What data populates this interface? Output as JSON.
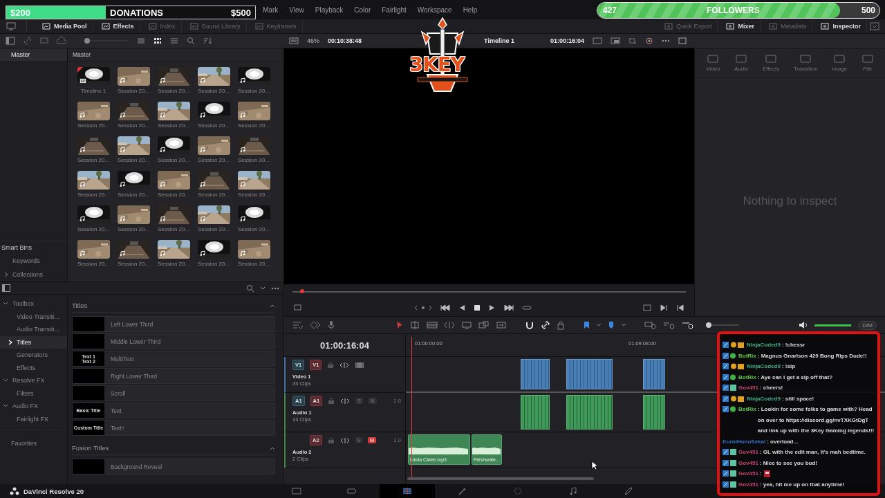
{
  "overlays": {
    "donations": {
      "current": "$200",
      "label": "DONATIONS",
      "goal": "$500",
      "level": 0.4
    },
    "followers": {
      "current": "427",
      "label": "FOLLOWERS",
      "goal": "500",
      "level": 0.86
    },
    "logo": {
      "text": "3KEY"
    }
  },
  "menu": [
    "Mark",
    "View",
    "Playback",
    "Color",
    "Fairlight",
    "Workspace",
    "Help"
  ],
  "toolbar": {
    "left": [
      {
        "label": "Media Pool",
        "selected": true
      },
      {
        "label": "Effects",
        "selected": true
      },
      {
        "label": "Index",
        "selected": false
      },
      {
        "label": "Sound Library",
        "selected": false
      },
      {
        "label": "Keyframes",
        "selected": false
      }
    ],
    "right": [
      {
        "label": "Quick Export",
        "selected": false
      },
      {
        "label": "Mixer",
        "selected": true
      },
      {
        "label": "Metadata",
        "selected": false
      },
      {
        "label": "Inspector",
        "selected": true
      }
    ]
  },
  "viewer": {
    "zoom": "46%",
    "duration": "00:10:38:48",
    "timeline": "Timeline 1",
    "timecode": "01:00:16:04",
    "scrub": {
      "level": 0.025
    }
  },
  "media_pool": {
    "size_slider": {
      "level": 0
    },
    "bins": [
      {
        "label": "Master",
        "selected": true
      }
    ],
    "smart_bins": {
      "title": "Smart Bins",
      "items": [
        {
          "label": "Keywords",
          "expandable": false
        },
        {
          "label": "Collections",
          "expandable": true
        }
      ]
    },
    "header": "Master",
    "clips": [
      {
        "label": "Timeline 1",
        "kind": "timeline"
      },
      {
        "label": "Session 20...",
        "kind": "audio"
      },
      {
        "label": "Session 20...",
        "kind": "audio"
      },
      {
        "label": "Session 20...",
        "kind": "audio"
      },
      {
        "label": "Session 20...",
        "kind": "audio"
      },
      {
        "label": "Session 20...",
        "kind": "audio"
      },
      {
        "label": "Session 20...",
        "kind": "audio"
      },
      {
        "label": "Session 20...",
        "kind": "audio"
      },
      {
        "label": "Session 20...",
        "kind": "audio"
      },
      {
        "label": "Session 20...",
        "kind": "audio"
      },
      {
        "label": "Session 20...",
        "kind": "audio"
      },
      {
        "label": "Session 20...",
        "kind": "audio"
      },
      {
        "label": "Session 20...",
        "kind": "audio"
      },
      {
        "label": "Session 20...",
        "kind": "audio"
      },
      {
        "label": "Session 20...",
        "kind": "audio"
      },
      {
        "label": "Session 20...",
        "kind": "audio"
      },
      {
        "label": "Session 20...",
        "kind": "audio"
      },
      {
        "label": "Session 20...",
        "kind": "audio"
      },
      {
        "label": "Session 20...",
        "kind": "audio"
      },
      {
        "label": "Session 20...",
        "kind": "audio"
      },
      {
        "label": "Session 20...",
        "kind": "audio"
      },
      {
        "label": "Session 20...",
        "kind": "audio"
      },
      {
        "label": "Session 20...",
        "kind": "audio"
      },
      {
        "label": "Session 20...",
        "kind": "audio"
      },
      {
        "label": "Session 20...",
        "kind": "audio"
      },
      {
        "label": "Session 20...",
        "kind": "audio"
      },
      {
        "label": "Session 20...",
        "kind": "audio"
      },
      {
        "label": "Session 20...",
        "kind": "audio"
      },
      {
        "label": "Session 20...",
        "kind": "audio"
      },
      {
        "label": "Session 20...",
        "kind": "audio"
      }
    ]
  },
  "inspector": {
    "tabs": [
      {
        "label": "Video",
        "disabled": true
      },
      {
        "label": "Audio",
        "disabled": true
      },
      {
        "label": "Effects",
        "disabled": true
      },
      {
        "label": "Transition",
        "disabled": true
      },
      {
        "label": "Image",
        "disabled": true
      },
      {
        "label": "File",
        "disabled": true
      }
    ],
    "empty_message": "Nothing to inspect"
  },
  "effects": {
    "tree": [
      {
        "label": "Toolbox",
        "expanded": true,
        "selected": false,
        "children": [
          {
            "label": "Video Transiti...",
            "selected": false
          },
          {
            "label": "Audio Transiti...",
            "selected": false
          },
          {
            "label": "Titles",
            "selected": true
          },
          {
            "label": "Generators",
            "selected": false
          },
          {
            "label": "Effects",
            "selected": false
          }
        ]
      },
      {
        "label": "Resolve FX",
        "expanded": true,
        "selected": false,
        "children": [
          {
            "label": "Filters",
            "selected": false
          }
        ]
      },
      {
        "label": "Audio FX",
        "expanded": true,
        "selected": false,
        "children": [
          {
            "label": "Fairlight FX",
            "selected": false
          }
        ]
      }
    ],
    "favorites": "Favorites",
    "sections": [
      {
        "title": "Titles",
        "expanded": true,
        "items": [
          {
            "label": "Left Lower Third"
          },
          {
            "label": "Middle Lower Third"
          },
          {
            "label": "MultiText",
            "thumb": [
              "Text 1",
              "Text 2"
            ]
          },
          {
            "label": "Right Lower Third"
          },
          {
            "label": "Scroll"
          },
          {
            "label": "Text",
            "thumb": [
              "Basic Title"
            ]
          },
          {
            "label": "Text+",
            "thumb": [
              "Custom Title"
            ]
          }
        ]
      },
      {
        "title": "Fusion Titles",
        "expanded": true,
        "items": [
          {
            "label": "Background Reveal"
          }
        ]
      }
    ]
  },
  "timeline": {
    "timecode": "01:00:16:04",
    "ruler": [
      "01:00:00:00",
      "01:09:08:00"
    ],
    "volume": {
      "level": 0.97
    },
    "dim": "DIM",
    "zoom": {
      "level": 0
    },
    "tracks": [
      {
        "kind": "video",
        "source": "V1",
        "dest": "V1",
        "name": "Video 1",
        "count": "33 Clips"
      },
      {
        "kind": "audio",
        "source": "A1",
        "dest": "A1",
        "name": "Audio 1",
        "count": "33 Clips",
        "channels": "2.0",
        "solo_label": "S",
        "mute_label": "M",
        "solo": false,
        "muted": false
      },
      {
        "kind": "audio",
        "dest": "A2",
        "name": "Audio 2",
        "count": "2 Clips",
        "channels": "2.0",
        "solo_label": "S",
        "mute_label": "M",
        "solo": false,
        "muted": true,
        "clips": [
          "Linda Claire.mp3",
          "Fleshwate..."
        ]
      }
    ]
  },
  "chat": [
    {
      "kind": "mod",
      "user": "NinjaCoded9",
      "color": "#3fae82",
      "text": ": !chessr"
    },
    {
      "kind": "bot",
      "user": "BotRix",
      "color": "#5cc545",
      "text": ": Magnus Gnarlson 420 Bong Rips Dude!!"
    },
    {
      "kind": "mod",
      "user": "NinjaCoded9",
      "color": "#3fae82",
      "text": ": !sip"
    },
    {
      "kind": "bot",
      "user": "BotRix",
      "color": "#5cc545",
      "text": ": Aye can I get a sip off that?"
    },
    {
      "kind": "sub",
      "user": "Gov451",
      "color": "#c2466a",
      "text": ": cheers!"
    },
    {
      "kind": "mod",
      "user": "NinjaCoded9",
      "color": "#3fae82",
      "text": ": still space!"
    },
    {
      "kind": "bot",
      "user": "BotRix",
      "color": "#5cc545",
      "text": ": Lookin for some folks to game with? Head on over to https://discord.gg/nvTXKGtDgT and link up with the 3Key Gaming legends!!!"
    },
    {
      "kind": "plain",
      "user": "KuroiHonoSekai",
      "color": "#3b6fc4",
      "text": ": overload..."
    },
    {
      "kind": "sub",
      "user": "Gov451",
      "color": "#c2466a",
      "text": ": GL with the edit man, It's mah bedtime."
    },
    {
      "kind": "sub",
      "user": "Gov451",
      "color": "#c2466a",
      "text": ": Nice to see you bud!"
    },
    {
      "kind": "sub",
      "user": "Gov451",
      "color": "#c2466a",
      "text": ":",
      "emote": true
    },
    {
      "kind": "sub",
      "user": "Gov451",
      "color": "#c2466a",
      "text": ": yea, hit me up on that anytime!"
    }
  ],
  "status_bar": {
    "app": "DaVinci Resolve 20",
    "pages": [
      {
        "kind": "media",
        "selected": false
      },
      {
        "kind": "cut",
        "selected": false
      },
      {
        "kind": "edit",
        "selected": true
      },
      {
        "kind": "fusion",
        "selected": false
      },
      {
        "kind": "color",
        "selected": false
      },
      {
        "kind": "fairlight",
        "selected": false
      },
      {
        "kind": "deliver",
        "selected": false
      }
    ]
  }
}
